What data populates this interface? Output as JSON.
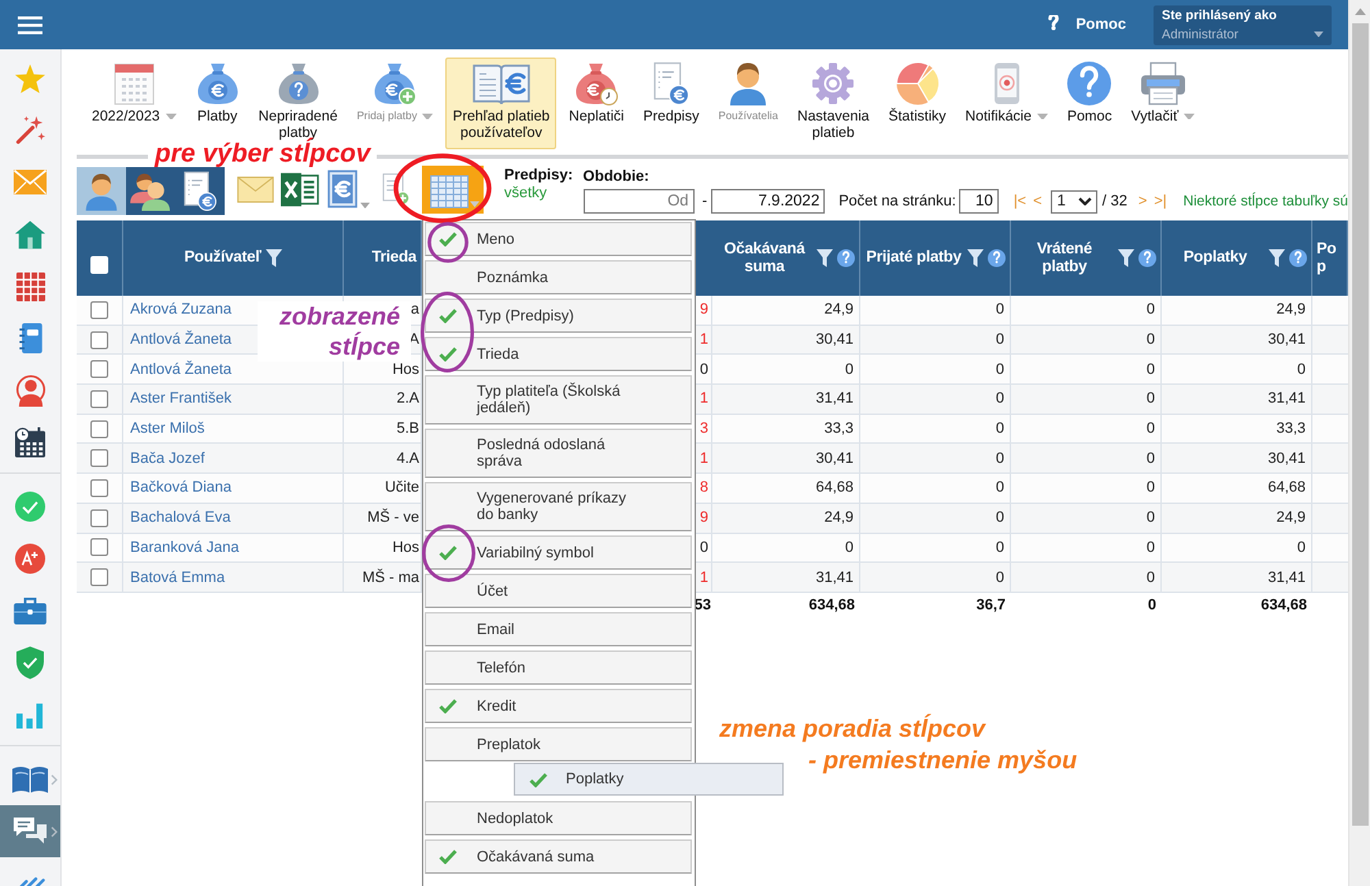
{
  "header": {
    "help": "Pomoc",
    "user": {
      "caption": "Ste prihlásený ako",
      "name": "Administrátor"
    }
  },
  "sidebar": {
    "groups": [
      [
        {
          "selected": false,
          "submenu": false
        },
        {
          "selected": false,
          "submenu": false
        },
        {
          "selected": false,
          "submenu": false
        },
        {
          "selected": false,
          "submenu": false
        },
        {
          "selected": false,
          "submenu": false
        },
        {
          "selected": false,
          "submenu": false
        },
        {
          "selected": false,
          "submenu": false
        },
        {
          "selected": false,
          "submenu": false
        }
      ],
      [
        {
          "selected": false,
          "submenu": false
        },
        {
          "selected": false,
          "submenu": false
        },
        {
          "selected": false,
          "submenu": false
        },
        {
          "selected": false,
          "submenu": false
        },
        {
          "selected": false,
          "submenu": false
        }
      ],
      [
        {
          "selected": false,
          "submenu": true
        },
        {
          "selected": true,
          "submenu": true
        },
        {
          "selected": false,
          "submenu": false
        }
      ]
    ]
  },
  "toolbar": {
    "items": [
      {
        "lines": [
          "2022/2023"
        ],
        "dropdown": true,
        "selected": false,
        "disabled": false
      },
      {
        "lines": [
          "Platby"
        ],
        "dropdown": false,
        "selected": false,
        "disabled": false
      },
      {
        "lines": [
          "Nepriradené",
          "platby"
        ],
        "dropdown": false,
        "selected": false,
        "disabled": false
      },
      {
        "lines": [
          "Pridaj platby"
        ],
        "dropdown": true,
        "selected": false,
        "disabled": true
      },
      {
        "lines": [
          "Prehľad platieb",
          "používateľov"
        ],
        "dropdown": false,
        "selected": true,
        "disabled": false
      },
      {
        "lines": [
          "Neplatiči"
        ],
        "dropdown": false,
        "selected": false,
        "disabled": false
      },
      {
        "lines": [
          "Predpisy"
        ],
        "dropdown": false,
        "selected": false,
        "disabled": false
      },
      {
        "lines": [
          "Používatelia"
        ],
        "dropdown": false,
        "selected": false,
        "disabled": true
      },
      {
        "lines": [
          "Nastavenia",
          "platieb"
        ],
        "dropdown": false,
        "selected": false,
        "disabled": false
      },
      {
        "lines": [
          "Štatistiky"
        ],
        "dropdown": false,
        "selected": false,
        "disabled": false
      },
      {
        "lines": [
          "Notifikácie"
        ],
        "dropdown": true,
        "selected": false,
        "disabled": false
      },
      {
        "lines": [
          "Pomoc"
        ],
        "dropdown": false,
        "selected": false,
        "disabled": false
      },
      {
        "lines": [
          "Vytlačiť"
        ],
        "dropdown": true,
        "selected": false,
        "disabled": false
      }
    ]
  },
  "options_bar": {
    "view_modes": [
      {
        "selected": true
      },
      {
        "selected": false
      },
      {
        "selected": false
      }
    ],
    "column_chooser": {
      "expanded": true
    },
    "prescriptions": {
      "label": "Predpisy:",
      "value": "všetky"
    },
    "period": {
      "label": "Obdobie:",
      "from": {
        "placeholder": "Od"
      },
      "separator": "-",
      "to": {
        "value": "7.9.2022"
      }
    },
    "page_size": {
      "label": "Počet na stránku:",
      "value": "10"
    },
    "pagination": {
      "first": "|<",
      "previous": "<",
      "page": "1",
      "total": "/ 32",
      "next": ">",
      "last": ">|"
    },
    "notice": "Niektoré stĺpce tabuľky sú"
  },
  "table": {
    "select_all": {
      "checked": false
    },
    "columns": [
      {
        "label": "Používateľ",
        "filter": true,
        "help": false
      },
      {
        "label": "Trieda"
      },
      {
        "label": "Očakávaná suma",
        "filter": true,
        "help": true
      },
      {
        "label": "Prijaté platby",
        "filter": true,
        "help": true
      },
      {
        "label": "Vrátené platby",
        "filter": true,
        "help": true
      },
      {
        "label": "Poplatky",
        "filter": true,
        "help": true
      },
      {
        "label": "Po p",
        "filter": false,
        "help": false
      }
    ],
    "rows": [
      {
        "checked": false,
        "name": "Akrová Zuzana",
        "column_3": "a",
        "column_4": {
          "text": "9",
          "warning": true
        },
        "values": [
          "24,9",
          "0",
          "0",
          "24,9"
        ]
      },
      {
        "checked": false,
        "name": "Antlová Žaneta",
        "column_3": "A",
        "column_4": {
          "text": "1",
          "warning": true
        },
        "values": [
          "30,41",
          "0",
          "0",
          "30,41"
        ]
      },
      {
        "checked": false,
        "name": "Antlová Žaneta",
        "column_3": "Hos",
        "column_4": {
          "text": "0",
          "warning": false
        },
        "values": [
          "0",
          "0",
          "0",
          "0"
        ]
      },
      {
        "checked": false,
        "name": "Aster František",
        "column_3": "2.A",
        "column_4": {
          "text": "1",
          "warning": true
        },
        "values": [
          "31,41",
          "0",
          "0",
          "31,41"
        ]
      },
      {
        "checked": false,
        "name": "Aster Miloš",
        "column_3": "5.B",
        "column_4": {
          "text": "3",
          "warning": true
        },
        "values": [
          "33,3",
          "0",
          "0",
          "33,3"
        ]
      },
      {
        "checked": false,
        "name": "Bača Jozef",
        "column_3": "4.A",
        "column_4": {
          "text": "1",
          "warning": true
        },
        "values": [
          "30,41",
          "0",
          "0",
          "30,41"
        ]
      },
      {
        "checked": false,
        "name": "Bačková Diana",
        "column_3": "Učite",
        "column_4": {
          "text": "8",
          "warning": true
        },
        "values": [
          "64,68",
          "0",
          "0",
          "64,68"
        ]
      },
      {
        "checked": false,
        "name": "Bachalová Eva",
        "column_3": "MŠ - ve",
        "column_4": {
          "text": "9",
          "warning": true
        },
        "values": [
          "24,9",
          "0",
          "0",
          "24,9"
        ]
      },
      {
        "checked": false,
        "name": "Baranková Jana",
        "column_3": "Hos",
        "column_4": {
          "text": "0",
          "warning": false
        },
        "values": [
          "0",
          "0",
          "0",
          "0"
        ]
      },
      {
        "checked": false,
        "name": "Batová Emma",
        "column_3": "MŠ - ma",
        "column_4": {
          "text": "1",
          "warning": true
        },
        "values": [
          "31,41",
          "0",
          "0",
          "31,41"
        ]
      }
    ],
    "totals": {
      "column_4": "53",
      "values": [
        "634,68",
        "36,7",
        "0",
        "634,68"
      ]
    }
  },
  "column_menu": {
    "items": [
      {
        "kind": "option",
        "label": "Meno",
        "checked": true
      },
      {
        "kind": "option",
        "label": "Poznámka",
        "checked": false
      },
      {
        "kind": "option",
        "label": "Typ (Predpisy)",
        "checked": true
      },
      {
        "kind": "option",
        "label": "Trieda",
        "checked": true
      },
      {
        "kind": "option",
        "label": "Typ platiteľa (Školská jedáleň)",
        "checked": false
      },
      {
        "kind": "option",
        "label": "Posledná odoslaná správa",
        "checked": false
      },
      {
        "kind": "option",
        "label": "Vygenerované príkazy do banky",
        "checked": false
      },
      {
        "kind": "option",
        "label": "Variabilný symbol",
        "checked": true
      },
      {
        "kind": "option",
        "label": "Účet",
        "checked": false
      },
      {
        "kind": "option",
        "label": "Email",
        "checked": false
      },
      {
        "kind": "option",
        "label": "Telefón",
        "checked": false
      },
      {
        "kind": "option",
        "label": "Kredit",
        "checked": true
      },
      {
        "kind": "option",
        "label": "Preplatok",
        "checked": false
      },
      {
        "kind": "drop_slot"
      },
      {
        "kind": "option",
        "label": "Nedoplatok",
        "checked": false
      },
      {
        "kind": "option",
        "label": "Očakávaná suma",
        "checked": true
      }
    ],
    "dragged_item": {
      "label": "Poplatky",
      "checked": true
    }
  },
  "annotations": [
    {
      "lines": [
        "pre výber stĺpcov"
      ],
      "color": "#ee1c24"
    },
    {
      "lines": [
        "zobrazené",
        "stĺpce"
      ],
      "color": "#a03ca0"
    },
    {
      "lines": [
        "zmena poradia stĺpcov",
        "- premiestnenie myšou"
      ],
      "color": "#f47b20"
    }
  ]
}
